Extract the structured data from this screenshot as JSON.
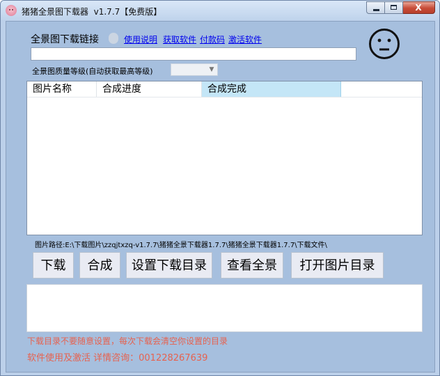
{
  "window": {
    "title": "猪猪全景图下载器  v1.7.7【免费版】",
    "close_glyph": "X"
  },
  "header": {
    "url_label": "全景图下载链接",
    "links": {
      "usage": "使用说明",
      "get_software": "获取软件",
      "payment_code": "付款码",
      "activate": "激活软件"
    },
    "url_value": "",
    "status_icon": "neutral-face-icon"
  },
  "quality": {
    "label": "全景图质量等级(自动获取最高等级)",
    "selected": ""
  },
  "table": {
    "columns": [
      "图片名称",
      "合成进度",
      "合成完成"
    ],
    "rows": []
  },
  "path_text": "图片路径:E:\\下载图片\\zzqjtxzq-v1.7.7\\猪猪全景下载器1.7.7\\猪猪全景下载器1.7.7\\下载文件\\",
  "buttons": {
    "download": "下载",
    "compose": "合成",
    "set_dir": "设置下载目录",
    "view_panorama": "查看全景",
    "open_dir": "打开图片目录"
  },
  "notes": {
    "line1": "下载目录不要随意设置，每次下载会清空你设置的目录",
    "line2": "软件使用及激活 详情咨询：001228267639"
  },
  "colors": {
    "client_bg": "#a6bfde",
    "note_red": "#e6624f",
    "link_blue": "#0000ee",
    "selected_header": "#c4e6f7"
  }
}
